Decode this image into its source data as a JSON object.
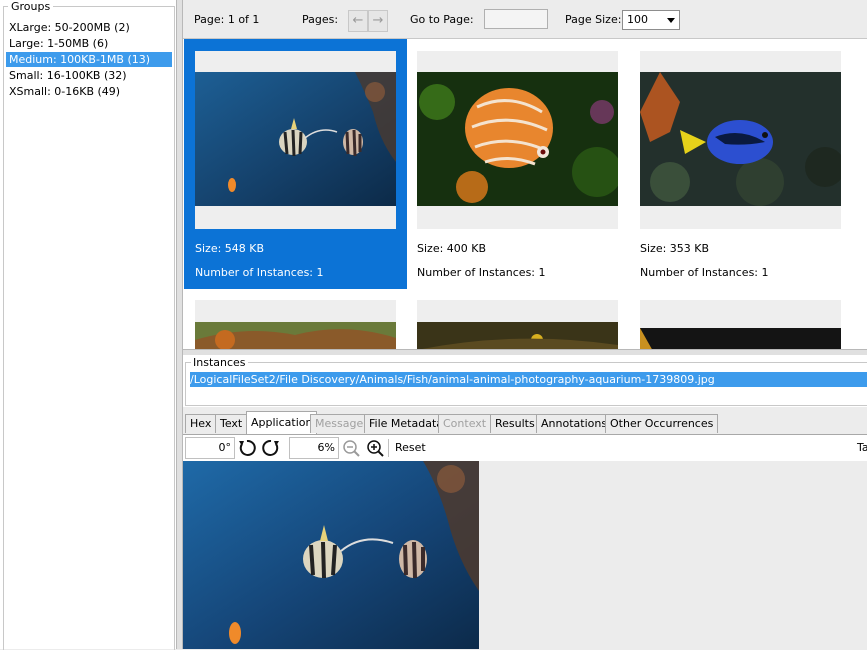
{
  "groups": {
    "title": "Groups",
    "items": [
      {
        "label": "XLarge: 50-200MB (2)"
      },
      {
        "label": "Large: 1-50MB (6)"
      },
      {
        "label": "Medium: 100KB-1MB (13)"
      },
      {
        "label": "Small: 16-100KB (32)"
      },
      {
        "label": "XSmall: 0-16KB (49)"
      }
    ],
    "selected_index": 2
  },
  "toolbar": {
    "page_label": "Page: 1 of 1",
    "pages_label": "Pages:",
    "prev_icon": "arrow-left-icon",
    "next_icon": "arrow-right-icon",
    "goto_label": "Go to Page:",
    "goto_value": "",
    "page_size_label": "Page Size:",
    "page_size_value": "100"
  },
  "tiles": [
    {
      "size": "Size: 548 KB",
      "instances": "Number of Instances: 1",
      "selected": true,
      "image": "angelfish-blue-water"
    },
    {
      "size": "Size: 400 KB",
      "instances": "Number of Instances: 1",
      "selected": false,
      "image": "discus-fish"
    },
    {
      "size": "Size: 353 KB",
      "instances": "Number of Instances: 1",
      "selected": false,
      "image": "blue-tang-fish"
    }
  ],
  "instances": {
    "title": "Instances",
    "path": "/LogicalFileSet2/File Discovery/Animals/Fish/animal-animal-photography-aquarium-1739809.jpg"
  },
  "tabs": [
    {
      "label": "Hex",
      "active": false,
      "disabled": false
    },
    {
      "label": "Text",
      "active": false,
      "disabled": false
    },
    {
      "label": "Application",
      "active": true,
      "disabled": false
    },
    {
      "label": "Message",
      "active": false,
      "disabled": true
    },
    {
      "label": "File Metadata",
      "active": false,
      "disabled": false
    },
    {
      "label": "Context",
      "active": false,
      "disabled": true
    },
    {
      "label": "Results",
      "active": false,
      "disabled": false
    },
    {
      "label": "Annotations",
      "active": false,
      "disabled": false
    },
    {
      "label": "Other Occurrences",
      "active": false,
      "disabled": false
    }
  ],
  "viewer": {
    "rotation": "0°",
    "zoom": "6%",
    "reset_label": "Reset",
    "truncated_label": "Ta",
    "icons": [
      "rotate-left-icon",
      "rotate-right-icon",
      "zoom-out-icon",
      "zoom-in-icon"
    ]
  },
  "colors": {
    "selection": "#0c73d6",
    "list_selection": "#3d9bec"
  }
}
